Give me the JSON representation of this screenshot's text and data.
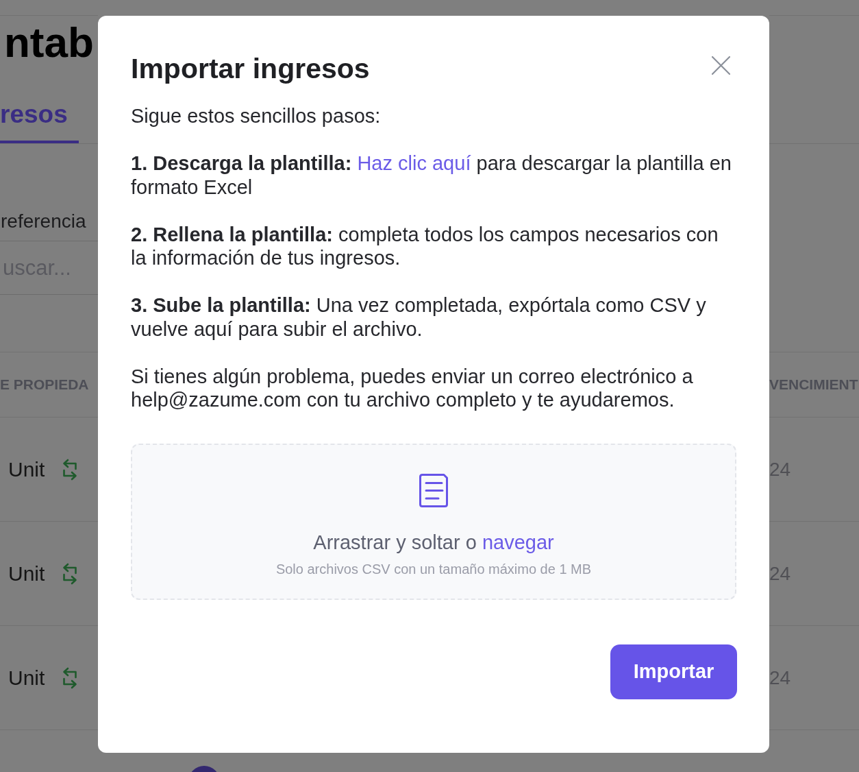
{
  "background": {
    "page_title": "ntab",
    "tabs": [
      {
        "label": "resos",
        "selected": true
      }
    ],
    "filter": {
      "label": "referencia",
      "placeholder": "uscar..."
    },
    "table": {
      "columns": [
        "E PROPIEDA",
        "VENCIMIENT"
      ],
      "rows": [
        {
          "cells": [
            "Unit",
            "24"
          ]
        },
        {
          "cells": [
            "Unit",
            "24"
          ]
        },
        {
          "cells": [
            "Unit",
            "24"
          ]
        }
      ]
    }
  },
  "dialog": {
    "title": "Importar ingresos",
    "intro": "Sigue estos sencillos pasos:",
    "steps": [
      {
        "title": "1. Descarga la plantilla:",
        "link": "Haz clic aquí",
        "text": "para descargar la plantilla en formato Excel"
      },
      {
        "title": "2. Rellena la plantilla:",
        "text": "completa todos los campos necesarios con la información de tus ingresos."
      },
      {
        "title": "3. Sube la plantilla:",
        "text": "Una vez completada, expórtala como CSV y vuelve aquí para subir el archivo."
      }
    ],
    "help": "Si tienes algún problema, puedes enviar un correo electrónico a help@zazume.com con tu archivo completo y te ayudaremos.",
    "dropzone": {
      "text": "Arrastrar y soltar o",
      "link": "navegar",
      "hint": "Solo archivos CSV con un tamaño máximo de 1 MB"
    },
    "buttons": [
      {
        "label": "Importar",
        "kind": "primary"
      }
    ]
  }
}
